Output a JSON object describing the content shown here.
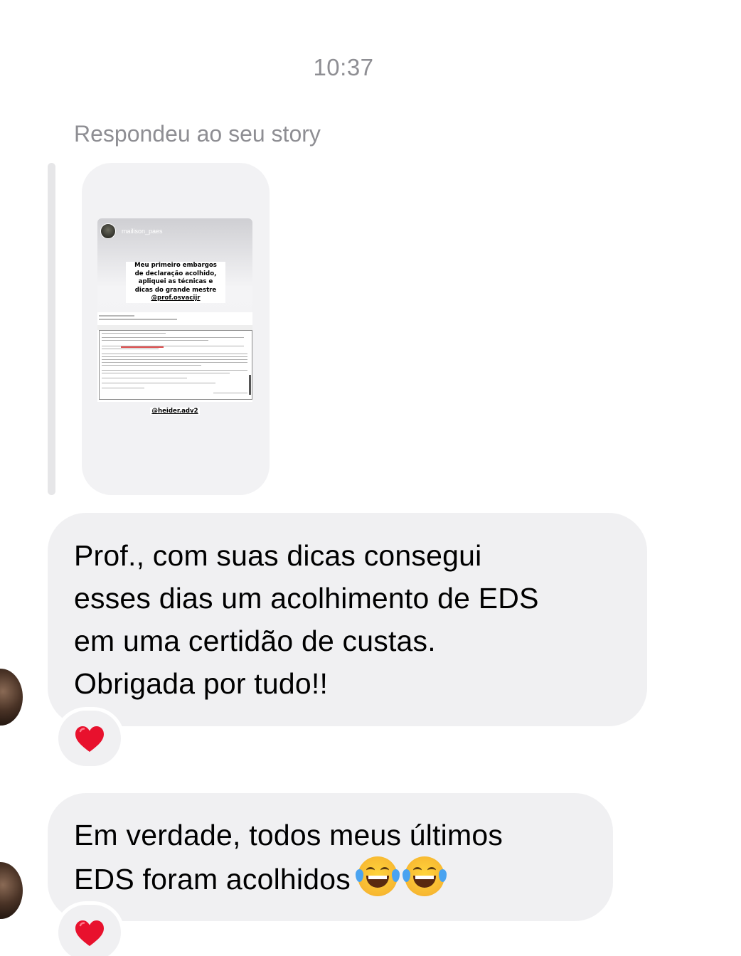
{
  "thread": {
    "timestamp": "10:37",
    "reply_context": "Respondeu ao seu story"
  },
  "story": {
    "username": "mailison_paes",
    "caption_lines": [
      "Meu primeiro embargos",
      "de declaração acolhido,",
      "apliquei as técnicas e",
      "dicas do grande mestre",
      "@prof.osvacijr"
    ],
    "footer_mention": "@heider.adv2"
  },
  "messages": [
    {
      "lines": [
        "Prof., com suas dicas consegui",
        "esses dias um acolhimento de EDS",
        "em uma certidão de custas.",
        "Obrigada por tudo!!"
      ],
      "reaction": "heart-icon"
    },
    {
      "lines": [
        "Em verdade, todos meus últimos",
        "EDS foram acolhidos"
      ],
      "emojis": [
        "face-with-tears-of-joy-icon",
        "face-with-tears-of-joy-icon"
      ],
      "reaction": "heart-icon"
    }
  ],
  "colors": {
    "bubble": "#f0f0f2",
    "meta_text": "#8e8e93",
    "heart": "#e8112d"
  }
}
